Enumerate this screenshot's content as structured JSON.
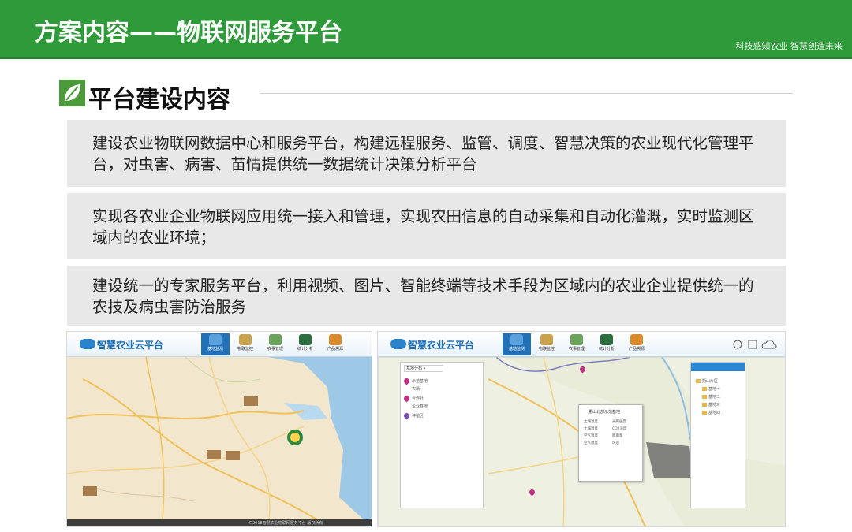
{
  "header": {
    "title": "方案内容——物联网服务平台",
    "tagline": "科技感知农业  智慧创造未来"
  },
  "section": {
    "title": "平台建设内容",
    "icon": "leaf-icon"
  },
  "blocks": [
    {
      "text": "建设农业物联网数据中心和服务平台，构建远程服务、监管、调度、智慧决策的农业现代化管理平台，对虫害、病害、苗情提供统一数据统计决策分析平台"
    },
    {
      "text": "实现各农业企业物联网应用统一接入和管理，实现农田信息的自动采集和自动化灌溉，实时监测区域内的农业环境；"
    },
    {
      "text": "建设统一的专家服务平台，利用视频、图片、智能终端等技术手段为区域内的农业企业提供统一的农技及病虫害防治服务"
    }
  ],
  "screenshots": [
    {
      "brand": "智慧农业云平台",
      "nav": [
        "基地监测",
        "物联监控",
        "农事管理",
        "统计分析",
        "产品溯源"
      ],
      "status": "©2018智慧农业物联网服务平台 版权所有"
    },
    {
      "brand": "智慧农业云平台",
      "nav": [
        "基地监测",
        "物联监控",
        "农事管理",
        "统计分析",
        "产品溯源"
      ],
      "side_select": "基地分布 ▾",
      "side_items": [
        "示范基地",
        "农场",
        "合作社",
        "企业基地",
        "种植区"
      ],
      "popup_title": "衢山北部示范基地",
      "popup_rows": [
        "土壤温度",
        "土壤湿度",
        "空气温度",
        "空气湿度",
        "光照强度",
        "CO2浓度",
        "降雨量",
        "风速"
      ],
      "tree_items": [
        "衢山片区",
        "基地一",
        "基地二",
        "基地三",
        "基地四"
      ]
    }
  ],
  "colors": {
    "header_green": "#2f9a3a",
    "block_gray": "#e8e8e8",
    "nav_active": "#2270b8"
  }
}
